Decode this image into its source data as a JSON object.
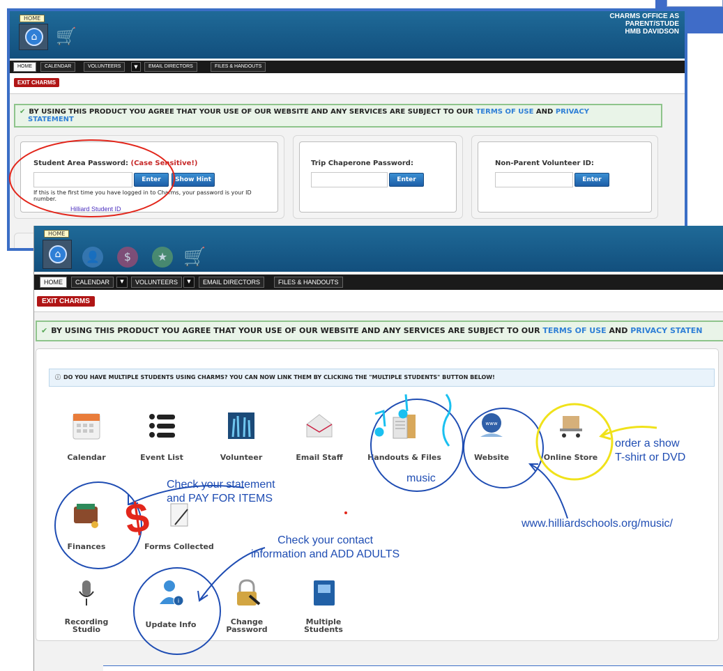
{
  "top": {
    "home_badge": "HOME",
    "title_lines": [
      "CHARMS OFFICE AS",
      "PARENT/STUDE",
      "HMB DAVIDSON"
    ],
    "nav": {
      "home": "HOME",
      "calendar": "CALENDAR",
      "volunteers": "VOLUNTEERS",
      "email": "EMAIL DIRECTORS",
      "files": "FILES & HANDOUTS",
      "dropdown": "▼"
    },
    "exit": "EXIT CHARMS",
    "notice": {
      "text": "BY USING THIS PRODUCT YOU AGREE THAT YOUR USE OF OUR WEBSITE AND ANY SERVICES ARE SUBJECT TO OUR",
      "terms": "TERMS OF USE",
      "and": "AND",
      "privacy": "PRIVACY",
      "statement": "STATEMENT"
    },
    "student": {
      "title": "Student Area Password:",
      "case": "(Case Sensitive!)",
      "enter": "Enter",
      "hint_btn": "Show Hint",
      "hint_text": "If this is the first time you have logged in to Charms, your password is your ID number.",
      "handwritten": "Hilliard Student ID"
    },
    "trip": {
      "title": "Trip Chaperone Password:",
      "enter": "Enter"
    },
    "volunteer": {
      "title": "Non-Parent Volunteer ID:",
      "enter": "Enter"
    }
  },
  "bottom": {
    "home_badge": "HOME",
    "nav": {
      "home": "HOME",
      "calendar": "CALENDAR",
      "volunteers": "VOLUNTEERS",
      "email": "EMAIL DIRECTORS",
      "files": "FILES & HANDOUTS",
      "dropdown": "▼"
    },
    "exit": "EXIT CHARMS",
    "notice": {
      "text": "BY USING THIS PRODUCT YOU AGREE THAT YOUR USE OF OUR WEBSITE AND ANY SERVICES ARE SUBJECT TO OUR",
      "terms": "TERMS OF USE",
      "and": "AND",
      "privacy": "PRIVACY STATEN"
    },
    "info": "DO YOU HAVE MULTIPLE STUDENTS USING CHARMS? YOU CAN NOW LINK THEM BY CLICKING THE \"MULTIPLE STUDENTS\" BUTTON BELOW!",
    "apps_row1": [
      "Calendar",
      "Event List",
      "Volunteer",
      "Email Staff",
      "Handouts & Files",
      "Website",
      "Online Store"
    ],
    "apps_row2": [
      "Finances",
      "Forms Collected"
    ],
    "apps_row3": [
      "Recording Studio",
      "Update Info",
      "Change Password",
      "Multiple Students"
    ]
  },
  "annotations": {
    "music": "music",
    "store": [
      "order a show",
      "T-shirt or DVD"
    ],
    "statement": [
      "Check your statement",
      "and PAY FOR ITEMS"
    ],
    "website": "www.hilliardschools.org/music/",
    "contact": [
      "Check your contact",
      "information and ADD ADULTS"
    ],
    "dollar": "$"
  },
  "colors": {
    "accent": "#2f7fd6",
    "header": "#124f7d",
    "exit": "#b01515",
    "annotation_blue": "#1f4db3",
    "annotation_red": "#e2261b",
    "annotation_yellow": "#f0e21a"
  },
  "icons": [
    "home-icon",
    "user-icon",
    "dollar-icon",
    "star-icon",
    "cart-icon",
    "calendar-icon",
    "list-icon",
    "volunteer-icon",
    "email-icon",
    "folder-icon",
    "globe-icon",
    "store-icon",
    "wallet-icon",
    "forms-icon",
    "microphone-icon",
    "update-user-icon",
    "lock-icon",
    "multiple-students-icon"
  ]
}
